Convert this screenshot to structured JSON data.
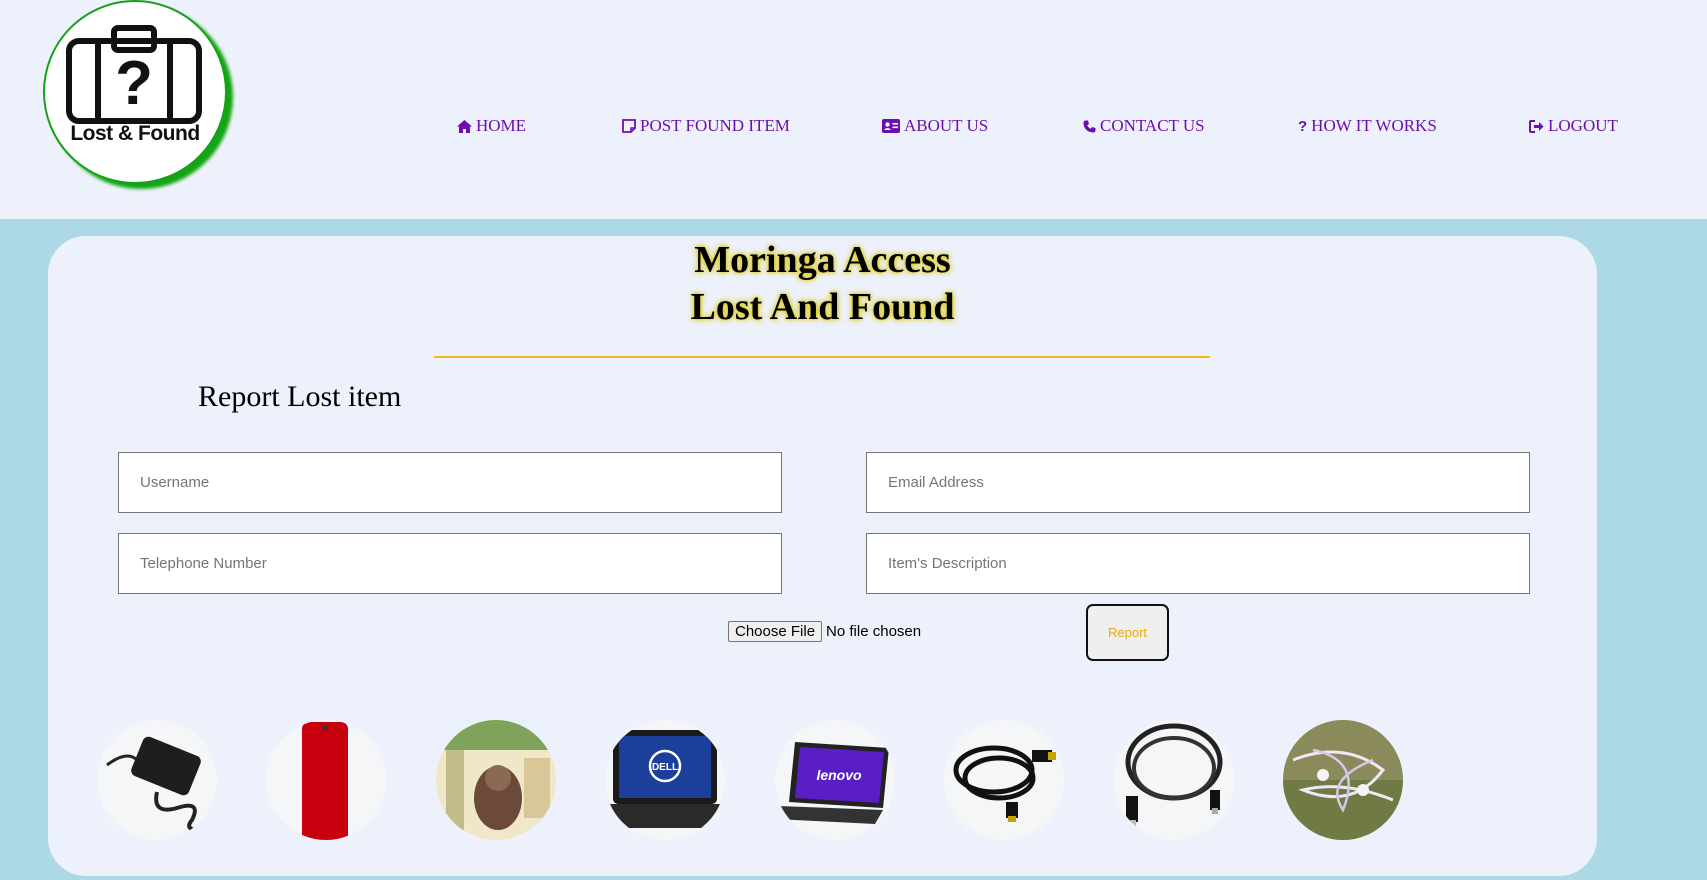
{
  "brand": {
    "logo_text": "Lost & Found",
    "logo_icon": "suitcase-question-icon"
  },
  "nav": [
    {
      "label": "HOME",
      "icon": "home-icon"
    },
    {
      "label": "POST FOUND ITEM",
      "icon": "note-icon"
    },
    {
      "label": "ABOUT US",
      "icon": "id-card-icon"
    },
    {
      "label": "CONTACT US",
      "icon": "phone-icon"
    },
    {
      "label": "HOW IT WORKS",
      "icon": "question-icon"
    },
    {
      "label": "LOGOUT",
      "icon": "sign-out-icon"
    }
  ],
  "hero": {
    "title_line1": "Moringa Access",
    "title_line2": "Lost And Found"
  },
  "form": {
    "heading": "Report Lost item",
    "username_placeholder": "Username",
    "email_placeholder": "Email Address",
    "phone_placeholder": "Telephone Number",
    "description_placeholder": "Item's Description",
    "file_button": "Choose File",
    "file_status": "No file chosen",
    "submit_label": "Report"
  },
  "gallery": [
    "charger-thumbnail",
    "red-phone-thumbnail",
    "banknote-thumbnail",
    "dell-laptop-thumbnail",
    "lenovo-laptop-thumbnail",
    "hdmi-cable-thumbnail",
    "usb-cable-thumbnail",
    "earphones-thumbnail"
  ],
  "colors": {
    "page_bg": "#add8e6",
    "panel_bg": "#edf1fb",
    "nav_text": "#6d0fae",
    "accent_gold": "#f2b91e",
    "logo_ring": "#17a11a"
  }
}
